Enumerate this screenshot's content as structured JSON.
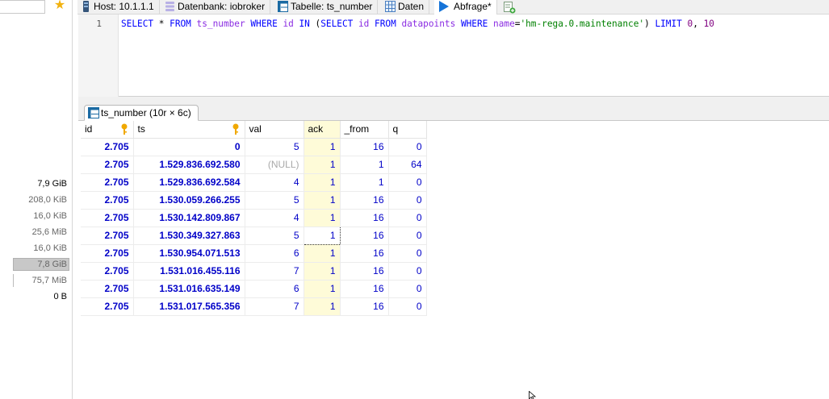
{
  "tabs": [
    {
      "label": "Host: 10.1.1.1",
      "icon": "server-icon"
    },
    {
      "label": "Datenbank: iobroker",
      "icon": "database-icon"
    },
    {
      "label": "Tabelle: ts_number",
      "icon": "table-icon"
    },
    {
      "label": "Daten",
      "icon": "grid-icon"
    },
    {
      "label": "Abfrage*",
      "icon": "play-icon"
    }
  ],
  "left_panel": {
    "sizes": [
      "7,9 GiB",
      "208,0 KiB",
      "16,0 KiB",
      "25,6 MiB",
      "16,0 KiB",
      "7,8 GiB",
      "75,7 MiB",
      "0 B"
    ]
  },
  "editor": {
    "line_number": "1",
    "query": "SELECT * FROM ts_number WHERE id IN (SELECT id FROM datapoints WHERE name='hm-rega.0.maintenance') LIMIT 0, 10"
  },
  "result": {
    "tab_label": "ts_number (10r × 6c)",
    "columns": [
      "id",
      "ts",
      "val",
      "ack",
      "_from",
      "q"
    ],
    "rows": [
      [
        "2.705",
        "0",
        "5",
        "1",
        "16",
        "0"
      ],
      [
        "2.705",
        "1.529.836.692.580",
        "(NULL)",
        "1",
        "1",
        "64"
      ],
      [
        "2.705",
        "1.529.836.692.584",
        "4",
        "1",
        "1",
        "0"
      ],
      [
        "2.705",
        "1.530.059.266.255",
        "5",
        "1",
        "16",
        "0"
      ],
      [
        "2.705",
        "1.530.142.809.867",
        "4",
        "1",
        "16",
        "0"
      ],
      [
        "2.705",
        "1.530.349.327.863",
        "5",
        "1",
        "16",
        "0"
      ],
      [
        "2.705",
        "1.530.954.071.513",
        "6",
        "1",
        "16",
        "0"
      ],
      [
        "2.705",
        "1.531.016.455.116",
        "7",
        "1",
        "16",
        "0"
      ],
      [
        "2.705",
        "1.531.016.635.149",
        "6",
        "1",
        "16",
        "0"
      ],
      [
        "2.705",
        "1.531.017.565.356",
        "7",
        "1",
        "16",
        "0"
      ]
    ]
  },
  "colors": {
    "value_blue": "#0000c8",
    "ack_highlight": "#fefbd8",
    "null_gray": "#a8a8a8",
    "sql_keyword": "#0000ff",
    "sql_identifier": "#8a2be2",
    "sql_string": "#008000"
  }
}
